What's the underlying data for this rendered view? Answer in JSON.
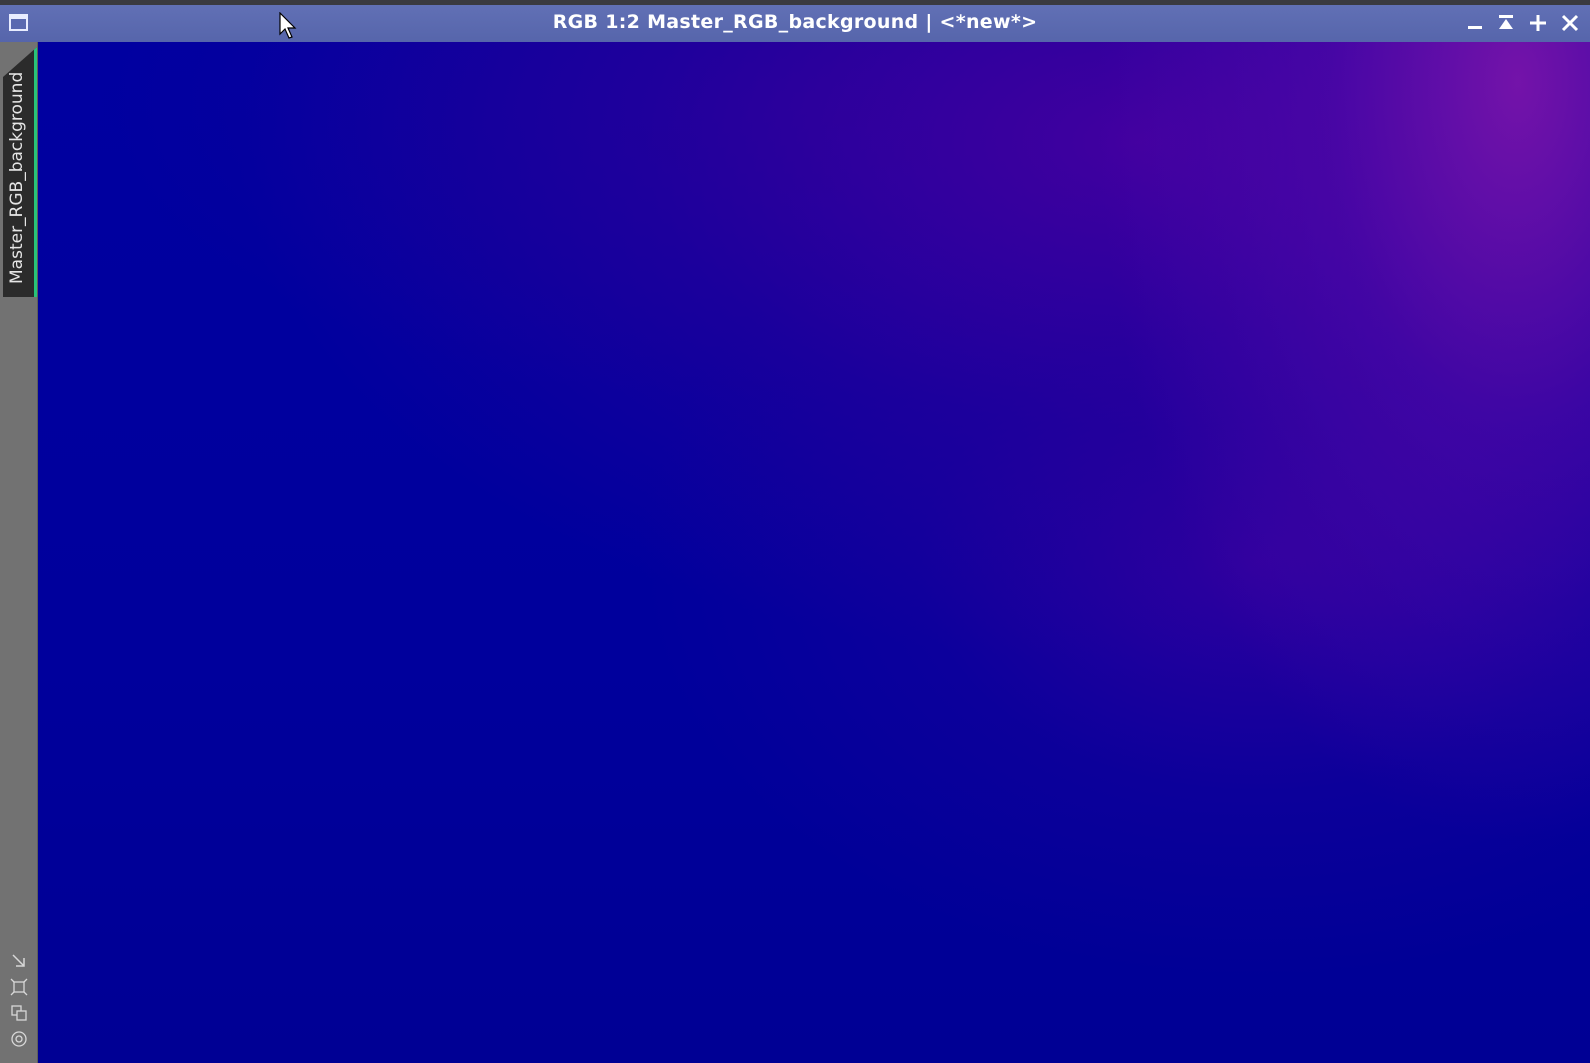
{
  "window": {
    "title": "RGB 1:2 Master_RGB_background | <*new*>"
  },
  "controls": {
    "minimize_icon": "minimize-icon",
    "shade_icon": "shade-icon",
    "maximize_icon": "maximize-icon",
    "close_icon": "close-icon"
  },
  "sidebar": {
    "tab_label": "Master_RGB_background",
    "active_tab_color": "#27c27a",
    "tools": [
      {
        "icon": "fit-view-icon"
      },
      {
        "icon": "zoom-frame-icon"
      },
      {
        "icon": "clone-icon"
      },
      {
        "icon": "target-icon"
      }
    ]
  },
  "image": {
    "base_color": "#00009a",
    "highlight_color": "#5a00a8"
  }
}
